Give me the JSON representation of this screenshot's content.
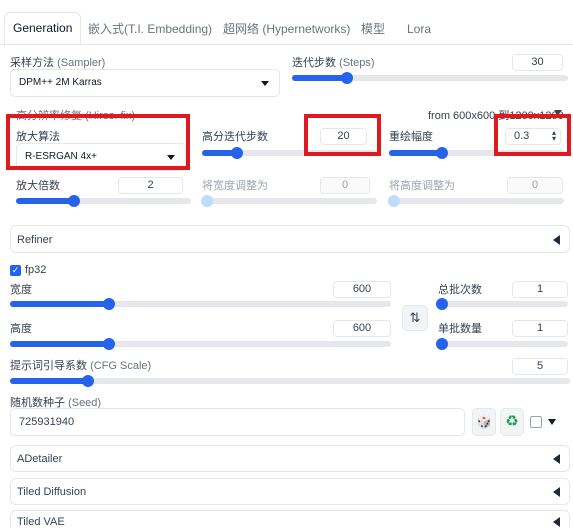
{
  "tabs": [
    {
      "label": "Generation"
    },
    {
      "label": "嵌入式(T.I. Embedding)"
    },
    {
      "label": "超网络 (Hypernetworks)"
    },
    {
      "label": "模型"
    },
    {
      "label": "Lora"
    }
  ],
  "sampler": {
    "label_cn": "采样方法",
    "label_en": "(Sampler)",
    "value": "DPM++ 2M Karras"
  },
  "steps": {
    "label_cn": "迭代步数",
    "label_en": "(Steps)",
    "value": "30",
    "fraction": 0.2
  },
  "hires": {
    "header_cn": "高分辨率修复",
    "header_en": "(Hires. fix)",
    "from_text": "from 600x600 到1200x1200",
    "upscaler": {
      "label": "放大算法",
      "value": "R-ESRGAN 4x+"
    },
    "hires_steps": {
      "label": "高分迭代步数",
      "value": "20",
      "fraction": 0.2
    },
    "denoise": {
      "label": "重绘幅度",
      "value": "0.3",
      "fraction": 0.3
    },
    "upscale_by": {
      "label": "放大倍数",
      "value": "2",
      "fraction": 0.33
    },
    "resize_width": {
      "label": "将宽度调整为",
      "value": "0"
    },
    "resize_height": {
      "label": "将高度调整为",
      "value": "0"
    }
  },
  "refiner": {
    "label": "Refiner"
  },
  "fp32": {
    "label": "fp32",
    "checked": true
  },
  "width": {
    "label": "宽度",
    "value": "600",
    "fraction": 0.26
  },
  "height": {
    "label": "高度",
    "value": "600",
    "fraction": 0.26
  },
  "swap_icon": "⇅",
  "batch_count": {
    "label": "总批次数",
    "value": "1",
    "fraction": 0.0
  },
  "batch_size": {
    "label": "单批数量",
    "value": "1",
    "fraction": 0.0
  },
  "cfg": {
    "label_cn": "提示词引导系数",
    "label_en": "(CFG Scale)",
    "value": "5",
    "fraction": 0.14
  },
  "seed": {
    "label_cn": "随机数种子",
    "label_en": "(Seed)",
    "value": "725931940",
    "dice_icon": "🎲",
    "recycle_icon": "♻"
  },
  "sections": [
    {
      "label": "ADetailer"
    },
    {
      "label": "Tiled Diffusion"
    },
    {
      "label": "Tiled VAE"
    }
  ],
  "colors": {
    "accent": "#2563eb",
    "highlight": "#e0191e",
    "recycle": "#16a34a"
  }
}
